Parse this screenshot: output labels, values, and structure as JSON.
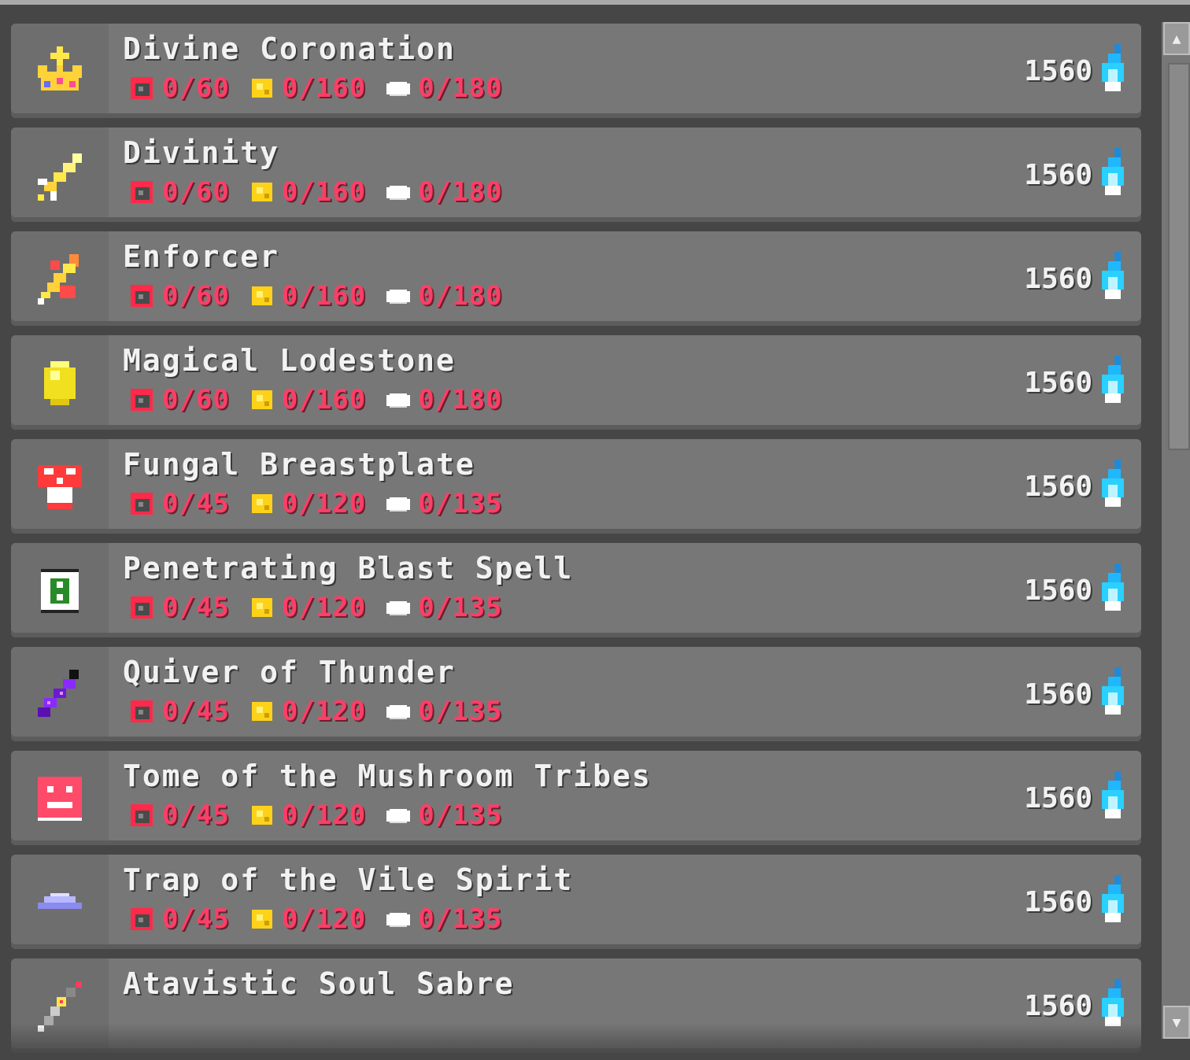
{
  "items": [
    {
      "name": "Divine Coronation",
      "icon": "crown-icon",
      "req": [
        "0/60",
        "0/160",
        "0/180"
      ],
      "price": "1560"
    },
    {
      "name": "Divinity",
      "icon": "sword-icon",
      "req": [
        "0/60",
        "0/160",
        "0/180"
      ],
      "price": "1560"
    },
    {
      "name": "Enforcer",
      "icon": "fire-sword-icon",
      "req": [
        "0/60",
        "0/160",
        "0/180"
      ],
      "price": "1560"
    },
    {
      "name": "Magical Lodestone",
      "icon": "yellow-gem-icon",
      "req": [
        "0/60",
        "0/160",
        "0/180"
      ],
      "price": "1560"
    },
    {
      "name": "Fungal Breastplate",
      "icon": "mushroom-armor-icon",
      "req": [
        "0/45",
        "0/120",
        "0/135"
      ],
      "price": "1560"
    },
    {
      "name": "Penetrating Blast Spell",
      "icon": "spell-scroll-icon",
      "req": [
        "0/45",
        "0/120",
        "0/135"
      ],
      "price": "1560"
    },
    {
      "name": "Quiver of Thunder",
      "icon": "quiver-icon",
      "req": [
        "0/45",
        "0/120",
        "0/135"
      ],
      "price": "1560"
    },
    {
      "name": "Tome of the Mushroom Tribes",
      "icon": "tome-icon",
      "req": [
        "0/45",
        "0/120",
        "0/135"
      ],
      "price": "1560"
    },
    {
      "name": "Trap of the Vile Spirit",
      "icon": "trap-icon",
      "req": [
        "0/45",
        "0/120",
        "0/135"
      ],
      "price": "1560"
    },
    {
      "name": "Atavistic Soul Sabre",
      "icon": "sabre-icon",
      "req": [],
      "price": "1560"
    }
  ],
  "resource_icons": [
    "red-ore-icon",
    "gold-ore-icon",
    "white-stone-icon"
  ],
  "currency_icon": "blue-flame-icon",
  "colors": {
    "requirement_text": "#ff3e66",
    "row_bg": "#777777",
    "page_bg": "#464646",
    "flame": "#1fb8ff"
  }
}
